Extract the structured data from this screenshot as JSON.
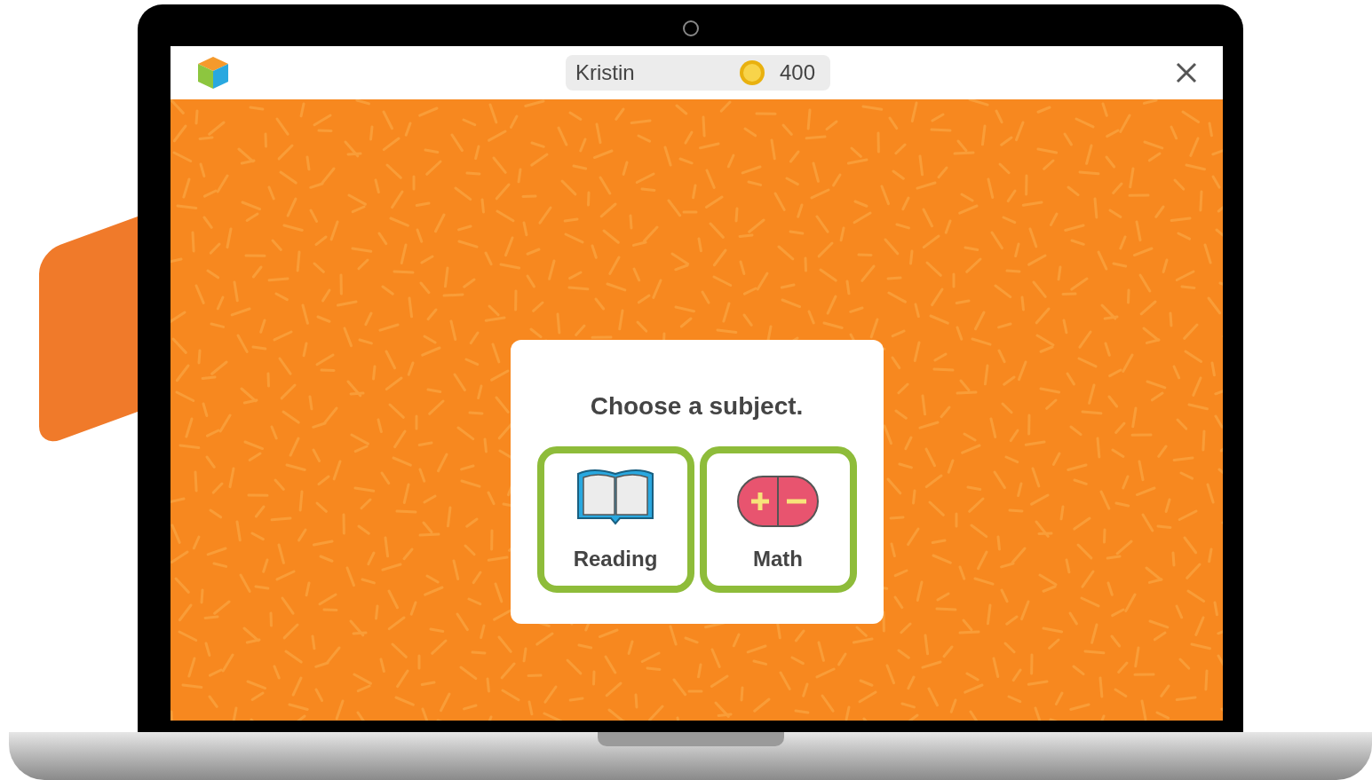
{
  "top_bar": {
    "user_name": "Kristin",
    "coins": "400"
  },
  "dialog": {
    "title": "Choose a subject.",
    "subjects": [
      {
        "label": "Reading",
        "kind": "book",
        "highlighted": true
      },
      {
        "label": "Math",
        "kind": "math",
        "highlighted": true
      }
    ]
  }
}
